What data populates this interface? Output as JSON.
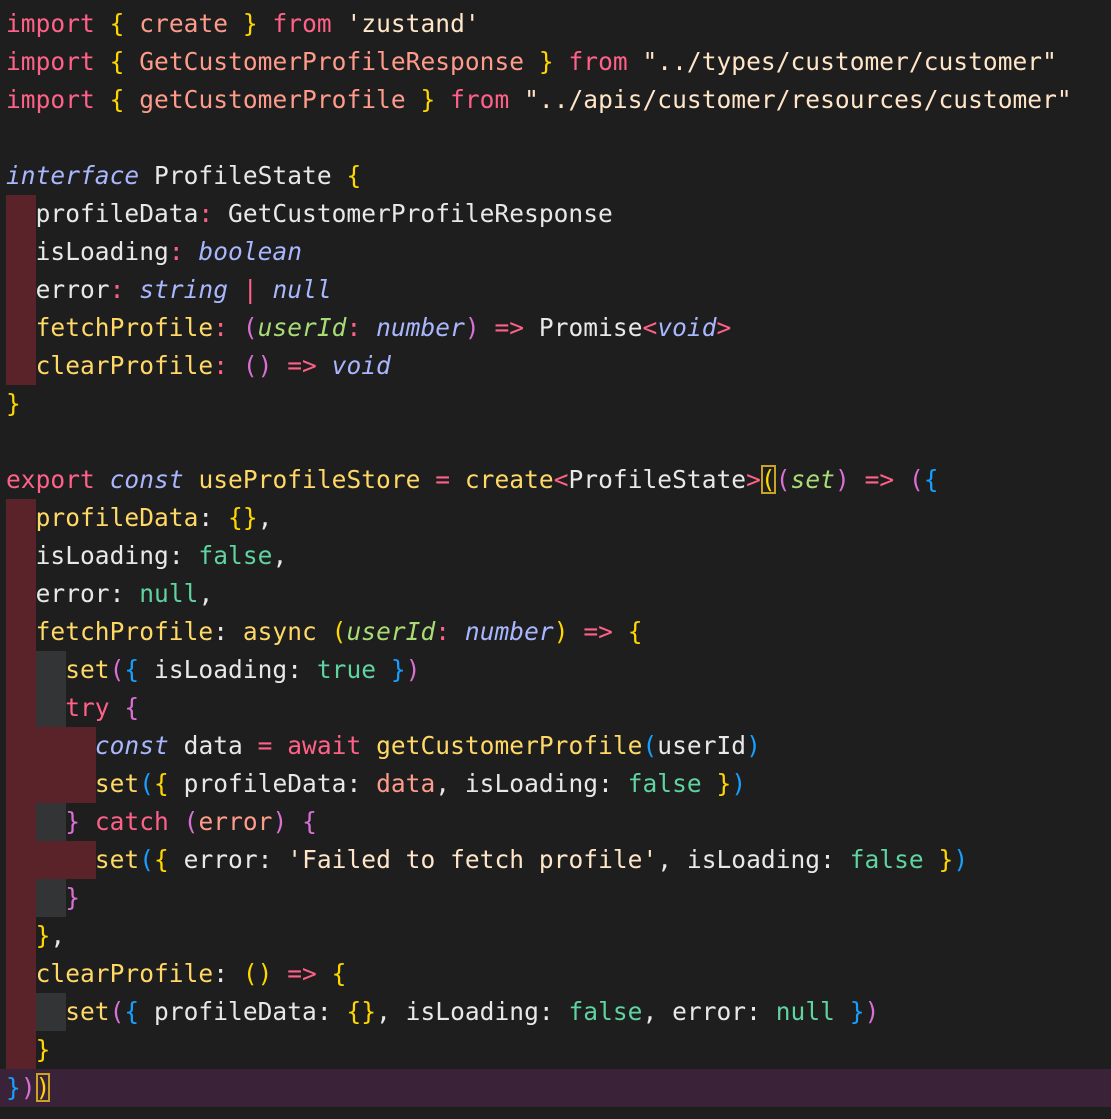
{
  "editor": {
    "colors": {
      "background": "#1e1e1e",
      "current_line": "#3a2238",
      "guide_error": "#5a2329",
      "guide_normal": "#333436",
      "bracket_match": "#c9a227",
      "kw_import": "#ff6188",
      "brace1": "#ffd700",
      "brace2": "#da70d6",
      "brace3": "#179fff",
      "string": "#ffe6a3",
      "property": "#ffd866",
      "type_italic": "#a9b7ff",
      "param": "#a9dc76",
      "literal": "#5fd3a0",
      "identifier": "#e8e8e8",
      "punct": "#d4d4d4"
    },
    "lines": [
      {
        "guides": [],
        "tokens": [
          {
            "t": "import",
            "c": "#ff6188"
          },
          {
            "t": " "
          },
          {
            "t": "{",
            "c": "#ffd700"
          },
          {
            "t": " create ",
            "c": "#ff9b8b"
          },
          {
            "t": "}",
            "c": "#ffd700"
          },
          {
            "t": " "
          },
          {
            "t": "from",
            "c": "#ff6188"
          },
          {
            "t": " "
          },
          {
            "t": "'zustand'",
            "c": "#ffe6c9"
          }
        ]
      },
      {
        "guides": [],
        "tokens": [
          {
            "t": "import",
            "c": "#ff6188"
          },
          {
            "t": " "
          },
          {
            "t": "{",
            "c": "#ffd700"
          },
          {
            "t": " GetCustomerProfileResponse ",
            "c": "#ff9b8b"
          },
          {
            "t": "}",
            "c": "#ffd700"
          },
          {
            "t": " "
          },
          {
            "t": "from",
            "c": "#ff6188"
          },
          {
            "t": " "
          },
          {
            "t": "\"../types/customer/customer\"",
            "c": "#ffe6c9"
          }
        ]
      },
      {
        "guides": [],
        "tokens": [
          {
            "t": "import",
            "c": "#ff6188"
          },
          {
            "t": " "
          },
          {
            "t": "{",
            "c": "#ffd700"
          },
          {
            "t": " getCustomerProfile ",
            "c": "#ff9b8b"
          },
          {
            "t": "}",
            "c": "#ffd700"
          },
          {
            "t": " "
          },
          {
            "t": "from",
            "c": "#ff6188"
          },
          {
            "t": " "
          },
          {
            "t": "\"../apis/customer/resources/customer\"",
            "c": "#ffe6c9"
          }
        ]
      },
      {
        "guides": [],
        "tokens": []
      },
      {
        "guides": [],
        "tokens": [
          {
            "t": "interface",
            "c": "#a9b7ff",
            "i": true
          },
          {
            "t": " "
          },
          {
            "t": "ProfileState",
            "c": "#e8e8e8"
          },
          {
            "t": " "
          },
          {
            "t": "{",
            "c": "#ffd700"
          }
        ]
      },
      {
        "guides": [
          "red"
        ],
        "tokens": [
          {
            "t": "  "
          },
          {
            "t": "profileData",
            "c": "#e8e8e8"
          },
          {
            "t": ": ",
            "c": "#ff6188"
          },
          {
            "t": "GetCustomerProfileResponse",
            "c": "#e8e8e8"
          }
        ]
      },
      {
        "guides": [
          "red"
        ],
        "tokens": [
          {
            "t": "  "
          },
          {
            "t": "isLoading",
            "c": "#e8e8e8"
          },
          {
            "t": ": ",
            "c": "#ff6188"
          },
          {
            "t": "boolean",
            "c": "#a9b7ff",
            "i": true
          }
        ]
      },
      {
        "guides": [
          "red"
        ],
        "tokens": [
          {
            "t": "  "
          },
          {
            "t": "error",
            "c": "#e8e8e8"
          },
          {
            "t": ": ",
            "c": "#ff6188"
          },
          {
            "t": "string",
            "c": "#a9b7ff",
            "i": true
          },
          {
            "t": " | ",
            "c": "#ff6188"
          },
          {
            "t": "null",
            "c": "#a9b7ff",
            "i": true
          }
        ]
      },
      {
        "guides": [
          "red"
        ],
        "tokens": [
          {
            "t": "  "
          },
          {
            "t": "fetchProfile",
            "c": "#ffd866"
          },
          {
            "t": ": ",
            "c": "#ff6188"
          },
          {
            "t": "(",
            "c": "#da70d6"
          },
          {
            "t": "userId",
            "c": "#a9dc76",
            "i": true
          },
          {
            "t": ": ",
            "c": "#ff6188"
          },
          {
            "t": "number",
            "c": "#a9b7ff",
            "i": true
          },
          {
            "t": ")",
            "c": "#da70d6"
          },
          {
            "t": " => ",
            "c": "#ff6188"
          },
          {
            "t": "Promise",
            "c": "#e8e8e8"
          },
          {
            "t": "<",
            "c": "#ff6188"
          },
          {
            "t": "void",
            "c": "#a9b7ff",
            "i": true
          },
          {
            "t": ">",
            "c": "#ff6188"
          }
        ]
      },
      {
        "guides": [
          "red"
        ],
        "tokens": [
          {
            "t": "  "
          },
          {
            "t": "clearProfile",
            "c": "#ffd866"
          },
          {
            "t": ": ",
            "c": "#ff6188"
          },
          {
            "t": "()",
            "c": "#da70d6"
          },
          {
            "t": " => ",
            "c": "#ff6188"
          },
          {
            "t": "void",
            "c": "#a9b7ff",
            "i": true
          }
        ]
      },
      {
        "guides": [],
        "tokens": [
          {
            "t": "}",
            "c": "#ffd700"
          }
        ]
      },
      {
        "guides": [],
        "tokens": []
      },
      {
        "guides": [],
        "tokens": [
          {
            "t": "export",
            "c": "#ff6188"
          },
          {
            "t": " "
          },
          {
            "t": "const",
            "c": "#a9b7ff",
            "i": true
          },
          {
            "t": " "
          },
          {
            "t": "useProfileStore",
            "c": "#ffd866"
          },
          {
            "t": " = ",
            "c": "#ff6188"
          },
          {
            "t": "create",
            "c": "#ffd866"
          },
          {
            "t": "<",
            "c": "#ff6188"
          },
          {
            "t": "ProfileState",
            "c": "#e8e8e8"
          },
          {
            "t": ">",
            "c": "#ff6188"
          },
          {
            "t": "(",
            "c": "#ffd700",
            "box": true
          },
          {
            "t": "(",
            "c": "#da70d6"
          },
          {
            "t": "set",
            "c": "#a9dc76",
            "i": true
          },
          {
            "t": ")",
            "c": "#da70d6"
          },
          {
            "t": " => ",
            "c": "#ff6188"
          },
          {
            "t": "(",
            "c": "#da70d6"
          },
          {
            "t": "{",
            "c": "#179fff"
          }
        ]
      },
      {
        "guides": [
          "red"
        ],
        "tokens": [
          {
            "t": "  "
          },
          {
            "t": "profileData",
            "c": "#ffd866"
          },
          {
            "t": ": ",
            "c": "#e8e8e8"
          },
          {
            "t": "{}",
            "c": "#ffd700"
          },
          {
            "t": ",",
            "c": "#e8e8e8"
          }
        ]
      },
      {
        "guides": [
          "red"
        ],
        "tokens": [
          {
            "t": "  "
          },
          {
            "t": "isLoading",
            "c": "#e8e8e8"
          },
          {
            "t": ": ",
            "c": "#e8e8e8"
          },
          {
            "t": "false",
            "c": "#5fd3a0"
          },
          {
            "t": ",",
            "c": "#e8e8e8"
          }
        ]
      },
      {
        "guides": [
          "red"
        ],
        "tokens": [
          {
            "t": "  "
          },
          {
            "t": "error",
            "c": "#e8e8e8"
          },
          {
            "t": ": ",
            "c": "#e8e8e8"
          },
          {
            "t": "null",
            "c": "#5fd3a0"
          },
          {
            "t": ",",
            "c": "#e8e8e8"
          }
        ]
      },
      {
        "guides": [
          "red"
        ],
        "tokens": [
          {
            "t": "  "
          },
          {
            "t": "fetchProfile",
            "c": "#ffd866"
          },
          {
            "t": ": ",
            "c": "#e8e8e8"
          },
          {
            "t": "async",
            "c": "#ffd866"
          },
          {
            "t": " "
          },
          {
            "t": "(",
            "c": "#ffd700"
          },
          {
            "t": "userId",
            "c": "#a9dc76",
            "i": true
          },
          {
            "t": ": ",
            "c": "#ff6188"
          },
          {
            "t": "number",
            "c": "#a9b7ff",
            "i": true
          },
          {
            "t": ")",
            "c": "#ffd700"
          },
          {
            "t": " => ",
            "c": "#ff6188"
          },
          {
            "t": "{",
            "c": "#ffd700"
          }
        ]
      },
      {
        "guides": [
          "red",
          "gray"
        ],
        "tokens": [
          {
            "t": "    "
          },
          {
            "t": "set",
            "c": "#ffd866"
          },
          {
            "t": "(",
            "c": "#da70d6"
          },
          {
            "t": "{",
            "c": "#179fff"
          },
          {
            "t": " isLoading",
            "c": "#e8e8e8"
          },
          {
            "t": ": ",
            "c": "#e8e8e8"
          },
          {
            "t": "true",
            "c": "#5fd3a0"
          },
          {
            "t": " "
          },
          {
            "t": "}",
            "c": "#179fff"
          },
          {
            "t": ")",
            "c": "#da70d6"
          }
        ]
      },
      {
        "guides": [
          "red",
          "gray"
        ],
        "tokens": [
          {
            "t": "    "
          },
          {
            "t": "try",
            "c": "#ff6188"
          },
          {
            "t": " "
          },
          {
            "t": "{",
            "c": "#da70d6"
          }
        ]
      },
      {
        "guides": [
          "red",
          "red",
          "red"
        ],
        "tokens": [
          {
            "t": "      "
          },
          {
            "t": "const",
            "c": "#a9b7ff",
            "i": true
          },
          {
            "t": " "
          },
          {
            "t": "data",
            "c": "#e8e8e8"
          },
          {
            "t": " = ",
            "c": "#ff6188"
          },
          {
            "t": "await",
            "c": "#ff6188"
          },
          {
            "t": " "
          },
          {
            "t": "getCustomerProfile",
            "c": "#ffd866"
          },
          {
            "t": "(",
            "c": "#179fff"
          },
          {
            "t": "userId",
            "c": "#e8e8e8"
          },
          {
            "t": ")",
            "c": "#179fff"
          }
        ]
      },
      {
        "guides": [
          "red",
          "red",
          "red"
        ],
        "tokens": [
          {
            "t": "      "
          },
          {
            "t": "set",
            "c": "#ffd866"
          },
          {
            "t": "(",
            "c": "#179fff"
          },
          {
            "t": "{",
            "c": "#ffd700"
          },
          {
            "t": " profileData",
            "c": "#e8e8e8"
          },
          {
            "t": ": ",
            "c": "#e8e8e8"
          },
          {
            "t": "data",
            "c": "#ff9b8b"
          },
          {
            "t": ", ",
            "c": "#e8e8e8"
          },
          {
            "t": "isLoading",
            "c": "#e8e8e8"
          },
          {
            "t": ": ",
            "c": "#e8e8e8"
          },
          {
            "t": "false",
            "c": "#5fd3a0"
          },
          {
            "t": " "
          },
          {
            "t": "}",
            "c": "#ffd700"
          },
          {
            "t": ")",
            "c": "#179fff"
          }
        ]
      },
      {
        "guides": [
          "red",
          "gray"
        ],
        "tokens": [
          {
            "t": "    "
          },
          {
            "t": "}",
            "c": "#da70d6"
          },
          {
            "t": " "
          },
          {
            "t": "catch",
            "c": "#ff6188"
          },
          {
            "t": " "
          },
          {
            "t": "(",
            "c": "#da70d6"
          },
          {
            "t": "error",
            "c": "#ff9b8b"
          },
          {
            "t": ")",
            "c": "#da70d6"
          },
          {
            "t": " "
          },
          {
            "t": "{",
            "c": "#da70d6"
          }
        ]
      },
      {
        "guides": [
          "red",
          "red",
          "red"
        ],
        "tokens": [
          {
            "t": "      "
          },
          {
            "t": "set",
            "c": "#ffd866"
          },
          {
            "t": "(",
            "c": "#179fff"
          },
          {
            "t": "{",
            "c": "#ffd700"
          },
          {
            "t": " error",
            "c": "#e8e8e8"
          },
          {
            "t": ": ",
            "c": "#e8e8e8"
          },
          {
            "t": "'Failed to fetch profile'",
            "c": "#ffe6c9"
          },
          {
            "t": ", ",
            "c": "#e8e8e8"
          },
          {
            "t": "isLoading",
            "c": "#e8e8e8"
          },
          {
            "t": ": ",
            "c": "#e8e8e8"
          },
          {
            "t": "false",
            "c": "#5fd3a0"
          },
          {
            "t": " "
          },
          {
            "t": "}",
            "c": "#ffd700"
          },
          {
            "t": ")",
            "c": "#179fff"
          }
        ]
      },
      {
        "guides": [
          "red",
          "gray"
        ],
        "tokens": [
          {
            "t": "    "
          },
          {
            "t": "}",
            "c": "#da70d6"
          }
        ]
      },
      {
        "guides": [
          "red"
        ],
        "tokens": [
          {
            "t": "  "
          },
          {
            "t": "}",
            "c": "#ffd700"
          },
          {
            "t": ",",
            "c": "#e8e8e8"
          }
        ]
      },
      {
        "guides": [
          "red"
        ],
        "tokens": [
          {
            "t": "  "
          },
          {
            "t": "clearProfile",
            "c": "#ffd866"
          },
          {
            "t": ": ",
            "c": "#e8e8e8"
          },
          {
            "t": "()",
            "c": "#ffd700"
          },
          {
            "t": " => ",
            "c": "#ff6188"
          },
          {
            "t": "{",
            "c": "#ffd700"
          }
        ]
      },
      {
        "guides": [
          "red",
          "gray"
        ],
        "tokens": [
          {
            "t": "    "
          },
          {
            "t": "set",
            "c": "#ffd866"
          },
          {
            "t": "(",
            "c": "#da70d6"
          },
          {
            "t": "{",
            "c": "#179fff"
          },
          {
            "t": " profileData",
            "c": "#e8e8e8"
          },
          {
            "t": ": ",
            "c": "#e8e8e8"
          },
          {
            "t": "{}",
            "c": "#ffd700"
          },
          {
            "t": ", ",
            "c": "#e8e8e8"
          },
          {
            "t": "isLoading",
            "c": "#e8e8e8"
          },
          {
            "t": ": ",
            "c": "#e8e8e8"
          },
          {
            "t": "false",
            "c": "#5fd3a0"
          },
          {
            "t": ", ",
            "c": "#e8e8e8"
          },
          {
            "t": "error",
            "c": "#e8e8e8"
          },
          {
            "t": ": ",
            "c": "#e8e8e8"
          },
          {
            "t": "null",
            "c": "#5fd3a0"
          },
          {
            "t": " "
          },
          {
            "t": "}",
            "c": "#179fff"
          },
          {
            "t": ")",
            "c": "#da70d6"
          }
        ]
      },
      {
        "guides": [
          "red"
        ],
        "tokens": [
          {
            "t": "  "
          },
          {
            "t": "}",
            "c": "#ffd700"
          }
        ]
      },
      {
        "guides": [],
        "current": true,
        "tokens": [
          {
            "t": "}",
            "c": "#179fff"
          },
          {
            "t": ")",
            "c": "#da70d6"
          },
          {
            "t": ")",
            "c": "#ffd700",
            "box": true
          }
        ]
      }
    ]
  }
}
